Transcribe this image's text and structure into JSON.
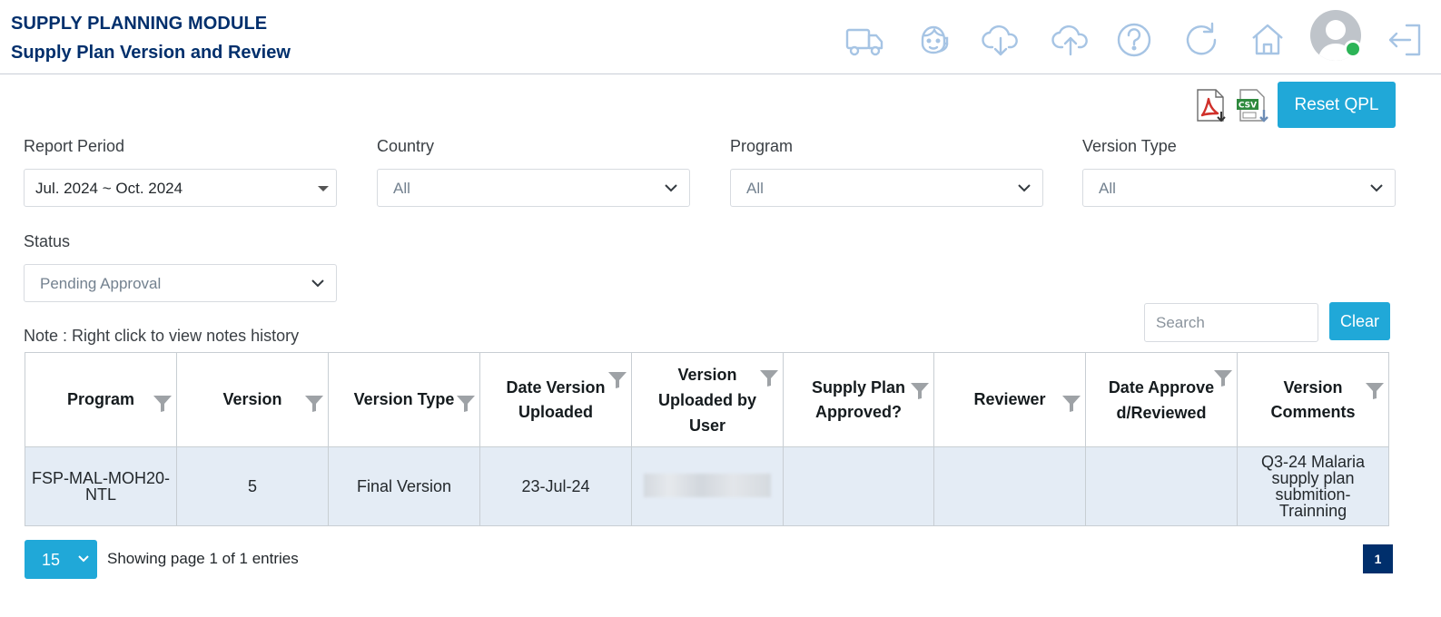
{
  "header": {
    "module_title": "SUPPLY PLANNING MODULE",
    "page_title": "Supply Plan Version and Review",
    "icons": [
      "truck-icon",
      "support-agent-icon",
      "cloud-download-icon",
      "cloud-upload-icon",
      "help-icon",
      "refresh-icon",
      "home-icon",
      "avatar",
      "logout-icon"
    ],
    "icon_color": "#a6c4e4",
    "online_status_color": "#2cb457"
  },
  "toolbar": {
    "reset_label": "Reset QPL",
    "accent_color": "#20a8d8"
  },
  "filters": {
    "report_period": {
      "label": "Report Period",
      "value": "Jul. 2024 ~ Oct. 2024"
    },
    "country": {
      "label": "Country",
      "value": "All"
    },
    "program": {
      "label": "Program",
      "value": "All"
    },
    "version_type": {
      "label": "Version Type",
      "value": "All"
    },
    "status": {
      "label": "Status",
      "value": "Pending Approval"
    }
  },
  "note": "Note : Right click to view notes history",
  "search": {
    "placeholder": "Search",
    "clear_label": "Clear"
  },
  "table": {
    "columns": [
      "Program",
      "Version",
      "Version Type",
      "Date Version Uploaded",
      "Version Uploaded by User",
      "Supply Plan Approved?",
      "Reviewer",
      "Date Approved/Reviewed",
      "Version Comments"
    ],
    "rows": [
      {
        "program": "FSP-MAL-MOH20-NTL",
        "version": "5",
        "version_type": "Final Version",
        "date_uploaded": "23-Jul-24",
        "uploaded_by": "",
        "approved": "",
        "reviewer": "",
        "date_approved": "",
        "comments": "Q3-24 Malaria supply plan submition-Trainning"
      }
    ],
    "row_color": "#e4ecf5"
  },
  "footer": {
    "page_size": "15",
    "showing": "Showing page 1 of 1 entries",
    "current_page": "1",
    "pager_color": "#002f6c"
  }
}
